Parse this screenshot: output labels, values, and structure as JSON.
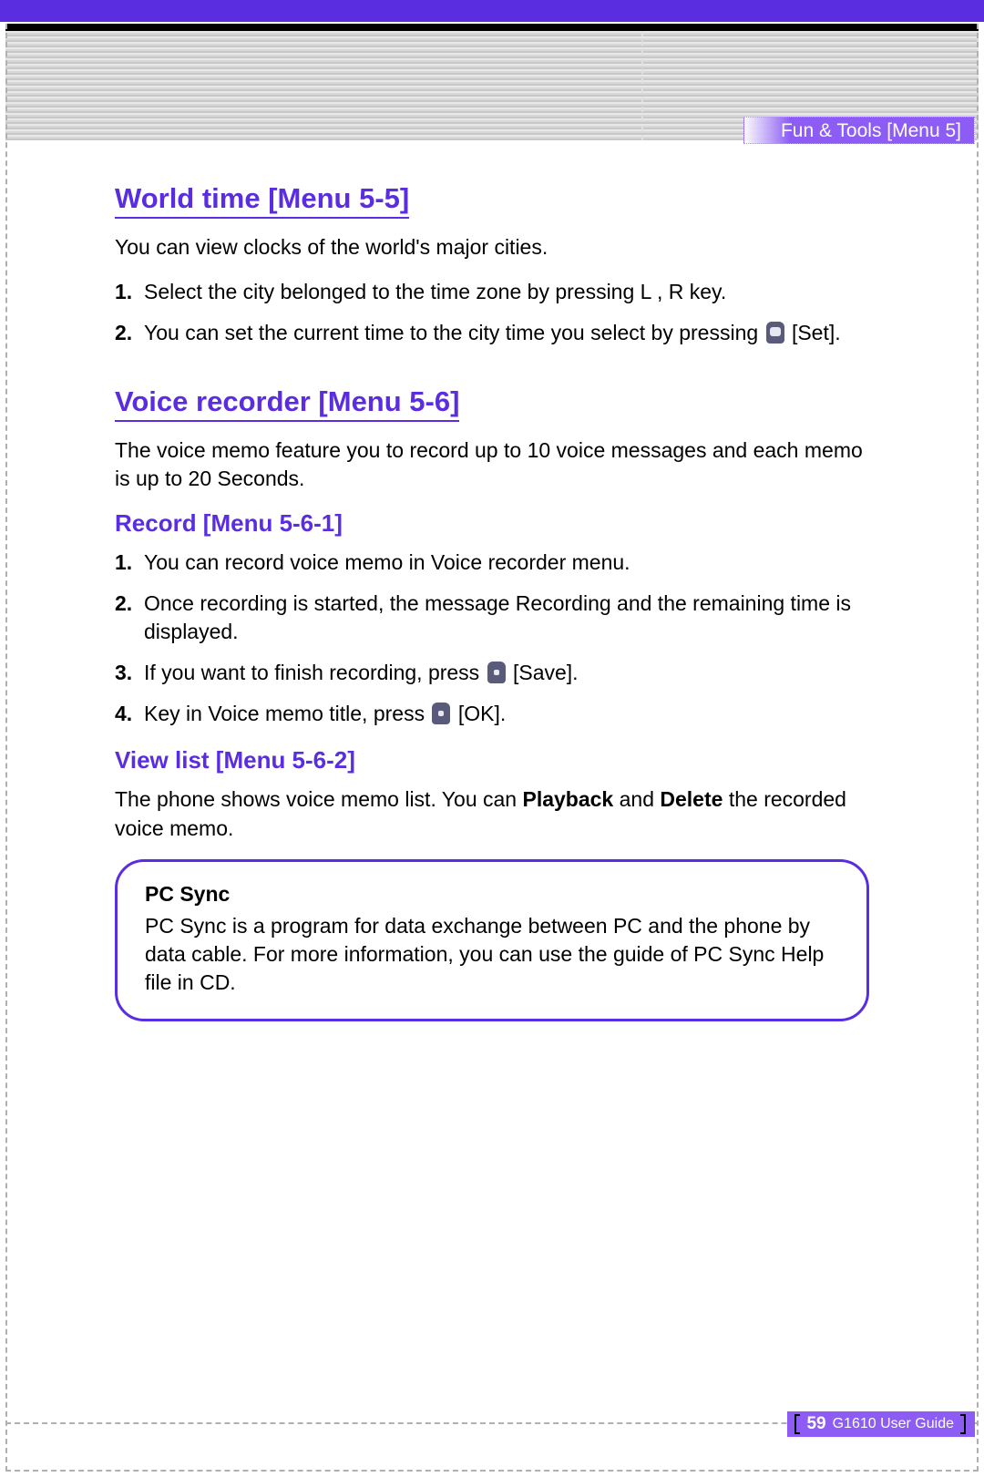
{
  "header": {
    "tab": "Fun & Tools [Menu 5]"
  },
  "sections": {
    "world_time": {
      "title": "World time [Menu 5-5]",
      "intro": "You can view clocks of the world's major cities.",
      "steps": [
        {
          "num": "1.",
          "text_a": " Select the city belonged to the time zone by pressing L , R key."
        },
        {
          "num": "2.",
          "text_a": "You can set the current time to the city time you select by pressing ",
          "key_after": "[Set]."
        }
      ]
    },
    "voice_recorder": {
      "title": "Voice recorder [Menu 5-6]",
      "intro": "The voice memo feature you to record up to 10 voice messages and each memo is up to 20 Seconds."
    },
    "record": {
      "title": "Record [Menu 5-6-1]",
      "steps": [
        {
          "num": "1.",
          "text_a": " You can record voice memo in Voice recorder menu."
        },
        {
          "num": "2.",
          "text_a": " Once recording is started, the message Recording and the remaining time is displayed."
        },
        {
          "num": "3.",
          "text_a": " If you want to finish recording, press ",
          "key_after": "[Save]."
        },
        {
          "num": "4.",
          "text_a": " Key in Voice memo title, press ",
          "key_after": "[OK]."
        }
      ]
    },
    "view_list": {
      "title": "View list [Menu 5-6-2]",
      "intro_a": "The phone shows voice memo list. You can ",
      "bold_a": "Playback",
      "mid": " and ",
      "bold_b": "Delete",
      "intro_b": " the recorded voice memo."
    },
    "note": {
      "title": "PC Sync",
      "body": "PC Sync is a program for data exchange between PC and the phone by data cable. For more information, you can use the guide of PC Sync Help file in CD."
    }
  },
  "footer": {
    "page": "59",
    "guide": "G1610 User Guide"
  }
}
